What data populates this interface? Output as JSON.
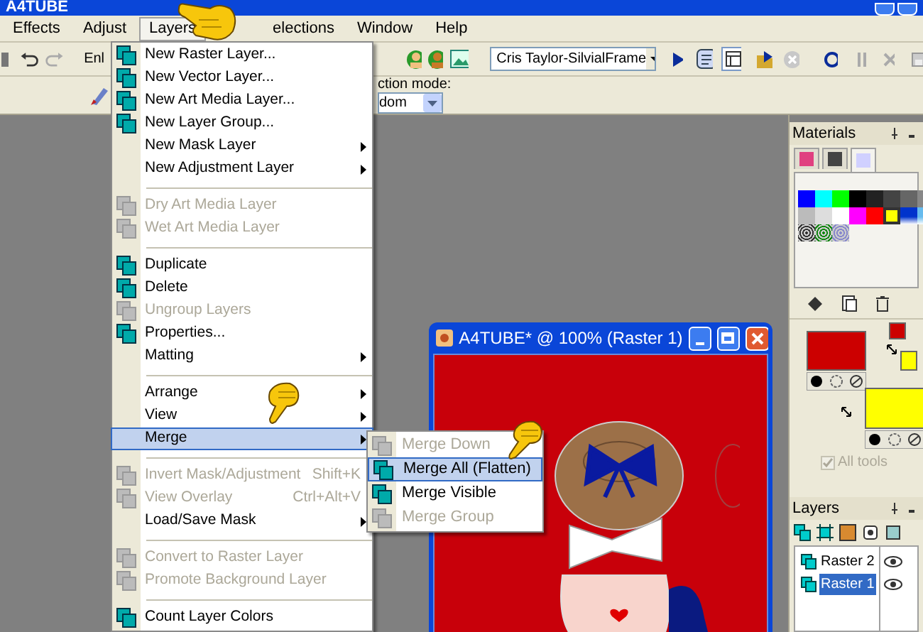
{
  "window": {
    "title": "A4TUBE"
  },
  "menu_bar": [
    {
      "label": "Effects",
      "selected": false
    },
    {
      "label": "Adjust",
      "selected": false
    },
    {
      "label": "Layers",
      "selected": true
    },
    {
      "label": "elections",
      "selected": false
    },
    {
      "label": "Window",
      "selected": false
    },
    {
      "label": "Help",
      "selected": false
    }
  ],
  "toolbar": {
    "label": "Enl",
    "preset": "Cris Taylor-SilvialFrame"
  },
  "tool_options": {
    "label": "ction mode:",
    "value": "dom"
  },
  "layers_menu": [
    {
      "kind": "item",
      "label": "New Raster Layer...",
      "icon": true,
      "disabled": false,
      "submenu": false,
      "selected": false
    },
    {
      "kind": "item",
      "label": "New Vector Layer...",
      "icon": true,
      "disabled": false,
      "submenu": false,
      "selected": false
    },
    {
      "kind": "item",
      "label": "New Art Media Layer...",
      "icon": true,
      "disabled": false,
      "submenu": false,
      "selected": false
    },
    {
      "kind": "item",
      "label": "New Layer Group...",
      "icon": true,
      "disabled": false,
      "submenu": false,
      "selected": false
    },
    {
      "kind": "item",
      "label": "New Mask Layer",
      "icon": false,
      "disabled": false,
      "submenu": true,
      "selected": false
    },
    {
      "kind": "item",
      "label": "New Adjustment Layer",
      "icon": false,
      "disabled": false,
      "submenu": true,
      "selected": false
    },
    {
      "kind": "separator"
    },
    {
      "kind": "item",
      "label": "Dry Art Media Layer",
      "icon": true,
      "disabled": true,
      "submenu": false,
      "selected": false
    },
    {
      "kind": "item",
      "label": "Wet Art Media Layer",
      "icon": true,
      "disabled": true,
      "submenu": false,
      "selected": false
    },
    {
      "kind": "separator"
    },
    {
      "kind": "item",
      "label": "Duplicate",
      "icon": true,
      "disabled": false,
      "submenu": false,
      "selected": false
    },
    {
      "kind": "item",
      "label": "Delete",
      "icon": true,
      "disabled": false,
      "submenu": false,
      "selected": false
    },
    {
      "kind": "item",
      "label": "Ungroup Layers",
      "icon": true,
      "disabled": true,
      "submenu": false,
      "selected": false
    },
    {
      "kind": "item",
      "label": "Properties...",
      "icon": true,
      "disabled": false,
      "submenu": false,
      "selected": false
    },
    {
      "kind": "item",
      "label": "Matting",
      "icon": false,
      "disabled": false,
      "submenu": true,
      "selected": false
    },
    {
      "kind": "separator"
    },
    {
      "kind": "item",
      "label": "Arrange",
      "icon": false,
      "disabled": false,
      "submenu": true,
      "selected": false
    },
    {
      "kind": "item",
      "label": "View",
      "icon": false,
      "disabled": false,
      "submenu": true,
      "selected": false
    },
    {
      "kind": "item",
      "label": "Merge",
      "icon": false,
      "disabled": false,
      "submenu": true,
      "selected": true
    },
    {
      "kind": "separator"
    },
    {
      "kind": "item",
      "label": "Invert Mask/Adjustment",
      "shortcut": "Shift+K",
      "icon": true,
      "disabled": true,
      "submenu": false,
      "selected": false
    },
    {
      "kind": "item",
      "label": "View Overlay",
      "shortcut": "Ctrl+Alt+V",
      "icon": true,
      "disabled": true,
      "submenu": false,
      "selected": false
    },
    {
      "kind": "item",
      "label": "Load/Save Mask",
      "icon": false,
      "disabled": false,
      "submenu": true,
      "selected": false
    },
    {
      "kind": "separator"
    },
    {
      "kind": "item",
      "label": "Convert to Raster Layer",
      "icon": true,
      "disabled": true,
      "submenu": false,
      "selected": false
    },
    {
      "kind": "item",
      "label": "Promote Background Layer",
      "icon": true,
      "disabled": true,
      "submenu": false,
      "selected": false
    },
    {
      "kind": "separator"
    },
    {
      "kind": "item",
      "label": "Count Layer Colors",
      "icon": true,
      "disabled": false,
      "submenu": false,
      "selected": false
    }
  ],
  "merge_submenu": [
    {
      "label": "Merge Down",
      "disabled": true,
      "selected": false
    },
    {
      "label": "Merge All (Flatten)",
      "disabled": false,
      "selected": true
    },
    {
      "label": "Merge Visible",
      "disabled": false,
      "selected": false
    },
    {
      "label": "Merge Group",
      "disabled": true,
      "selected": false
    }
  ],
  "image_window": {
    "title": "A4TUBE* @ 100% (Raster 1)"
  },
  "materials": {
    "title": "Materials",
    "tabs": [
      {
        "selected": false
      },
      {
        "selected": false
      },
      {
        "selected": true
      }
    ],
    "swatches": [
      {
        "kind": "solid",
        "color": "#0000ff",
        "selected": false
      },
      {
        "kind": "solid",
        "color": "#00ffff",
        "selected": false
      },
      {
        "kind": "solid",
        "color": "#00ff00",
        "selected": false
      },
      {
        "kind": "solid",
        "color": "#000000",
        "selected": false
      },
      {
        "kind": "solid",
        "color": "#222222",
        "selected": false
      },
      {
        "kind": "solid",
        "color": "#444444",
        "selected": false
      },
      {
        "kind": "solid",
        "color": "#666666",
        "selected": false
      },
      {
        "kind": "solid",
        "color": "#888888",
        "selected": false
      },
      {
        "kind": "solid",
        "color": "#bbbbbb",
        "selected": false
      },
      {
        "kind": "solid",
        "color": "#dddddd",
        "selected": false
      },
      {
        "kind": "solid",
        "color": "#ffffff",
        "selected": false
      },
      {
        "kind": "solid",
        "color": "#ff00ff",
        "selected": false
      },
      {
        "kind": "solid",
        "color": "#ff0000",
        "selected": false
      },
      {
        "kind": "solid",
        "color": "#ffff00",
        "selected": true
      },
      {
        "kind": "gradient",
        "color": "#0033cc",
        "selected": false
      },
      {
        "kind": "gradient",
        "color": "#66bbee",
        "selected": false
      },
      {
        "kind": "pattern",
        "color": "#333333",
        "selected": false
      },
      {
        "kind": "pattern",
        "color": "#118811",
        "selected": false
      },
      {
        "kind": "pattern",
        "color": "#8888cc",
        "selected": false
      }
    ],
    "foreground": {
      "color": "#cc0000"
    },
    "background": {
      "color": "#ffff00"
    },
    "all_tools": {
      "label": "All tools",
      "checked": true,
      "disabled": true
    }
  },
  "layers_palette": {
    "title": "Layers",
    "layers": [
      {
        "name": "Raster 2",
        "selected": false
      },
      {
        "name": "Raster 1",
        "selected": true
      }
    ]
  }
}
